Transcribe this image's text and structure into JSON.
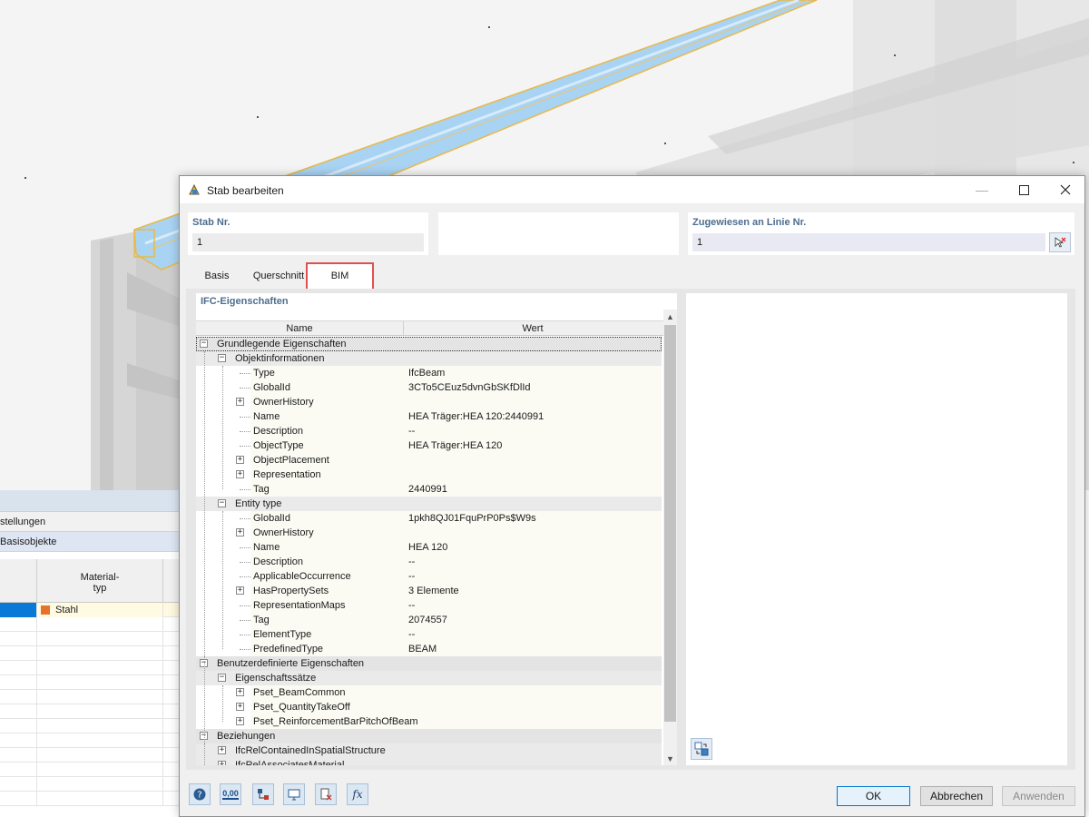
{
  "dialog": {
    "title": "Stab bearbeiten",
    "member_no_label": "Stab Nr.",
    "member_no_value": "1",
    "assigned_label": "Zugewiesen an Linie Nr.",
    "assigned_value": "1",
    "tabs": [
      {
        "label": "Basis",
        "active": false
      },
      {
        "label": "Querschnitt",
        "active": false
      },
      {
        "label": "BIM",
        "active": true
      }
    ],
    "section_title": "IFC-Eigenschaften",
    "columns": {
      "name": "Name",
      "value": "Wert"
    },
    "tree": [
      {
        "level": 0,
        "label": "Grundlegende Eigenschaften",
        "exp": "minus",
        "value": ""
      },
      {
        "level": 1,
        "label": "Objektinformationen",
        "exp": "minus",
        "value": ""
      },
      {
        "level": 2,
        "label": "Type",
        "exp": "",
        "value": "IfcBeam"
      },
      {
        "level": 2,
        "label": "GlobalId",
        "exp": "",
        "value": "3CTo5CEuz5dvnGbSKfDlId"
      },
      {
        "level": 2,
        "label": "OwnerHistory",
        "exp": "plus",
        "value": ""
      },
      {
        "level": 2,
        "label": "Name",
        "exp": "",
        "value": "HEA Träger:HEA 120:2440991"
      },
      {
        "level": 2,
        "label": "Description",
        "exp": "",
        "value": "--"
      },
      {
        "level": 2,
        "label": "ObjectType",
        "exp": "",
        "value": "HEA Träger:HEA 120"
      },
      {
        "level": 2,
        "label": "ObjectPlacement",
        "exp": "plus",
        "value": ""
      },
      {
        "level": 2,
        "label": "Representation",
        "exp": "plus",
        "value": ""
      },
      {
        "level": 2,
        "label": "Tag",
        "exp": "",
        "value": "2440991"
      },
      {
        "level": 1,
        "label": "Entity type",
        "exp": "minus",
        "value": ""
      },
      {
        "level": 2,
        "label": "GlobalId",
        "exp": "",
        "value": "1pkh8QJ01FquPrP0Ps$W9s"
      },
      {
        "level": 2,
        "label": "OwnerHistory",
        "exp": "plus",
        "value": ""
      },
      {
        "level": 2,
        "label": "Name",
        "exp": "",
        "value": "HEA 120"
      },
      {
        "level": 2,
        "label": "Description",
        "exp": "",
        "value": "--"
      },
      {
        "level": 2,
        "label": "ApplicableOccurrence",
        "exp": "",
        "value": "--"
      },
      {
        "level": 2,
        "label": "HasPropertySets",
        "exp": "plus",
        "value": "3 Elemente"
      },
      {
        "level": 2,
        "label": "RepresentationMaps",
        "exp": "",
        "value": "--"
      },
      {
        "level": 2,
        "label": "Tag",
        "exp": "",
        "value": "2074557"
      },
      {
        "level": 2,
        "label": "ElementType",
        "exp": "",
        "value": "--"
      },
      {
        "level": 2,
        "label": "PredefinedType",
        "exp": "",
        "value": "BEAM"
      },
      {
        "level": 0,
        "label": "Benutzerdefinierte Eigenschaften",
        "exp": "minus",
        "value": ""
      },
      {
        "level": 1,
        "label": "Eigenschaftssätze",
        "exp": "minus",
        "value": ""
      },
      {
        "level": 2,
        "label": "Pset_BeamCommon",
        "exp": "plus",
        "value": ""
      },
      {
        "level": 2,
        "label": "Pset_QuantityTakeOff",
        "exp": "plus",
        "value": ""
      },
      {
        "level": 2,
        "label": "Pset_ReinforcementBarPitchOfBeam",
        "exp": "plus",
        "value": ""
      },
      {
        "level": 0,
        "label": "Beziehungen",
        "exp": "minus",
        "value": ""
      },
      {
        "level": 1,
        "label": "IfcRelContainedInSpatialStructure",
        "exp": "plus",
        "value": ""
      },
      {
        "level": 1,
        "label": "IfcRelAssociatesMaterial",
        "exp": "plus",
        "value": ""
      }
    ],
    "buttons": {
      "ok": "OK",
      "cancel": "Abbrechen",
      "apply": "Anwenden"
    },
    "toolbar_icons": [
      "help-icon",
      "units-icon",
      "model-icon",
      "display-icon",
      "filter-icon",
      "function-icon"
    ],
    "toolbar_units_text": "0,00",
    "toolbar_function_text": "fx"
  },
  "background": {
    "row_settings": "stellungen",
    "row_base_objects": "Basisobjekte",
    "col_material_type": "Material-\ntyp",
    "material_value": "Stahl"
  },
  "colors": {
    "beam_blue": "#a9d3f2",
    "beam_outline": "#e8b94a",
    "active_tab_border": "#e05050",
    "label_blue": "#4d6d8e",
    "material_swatch": "#e6722b"
  }
}
